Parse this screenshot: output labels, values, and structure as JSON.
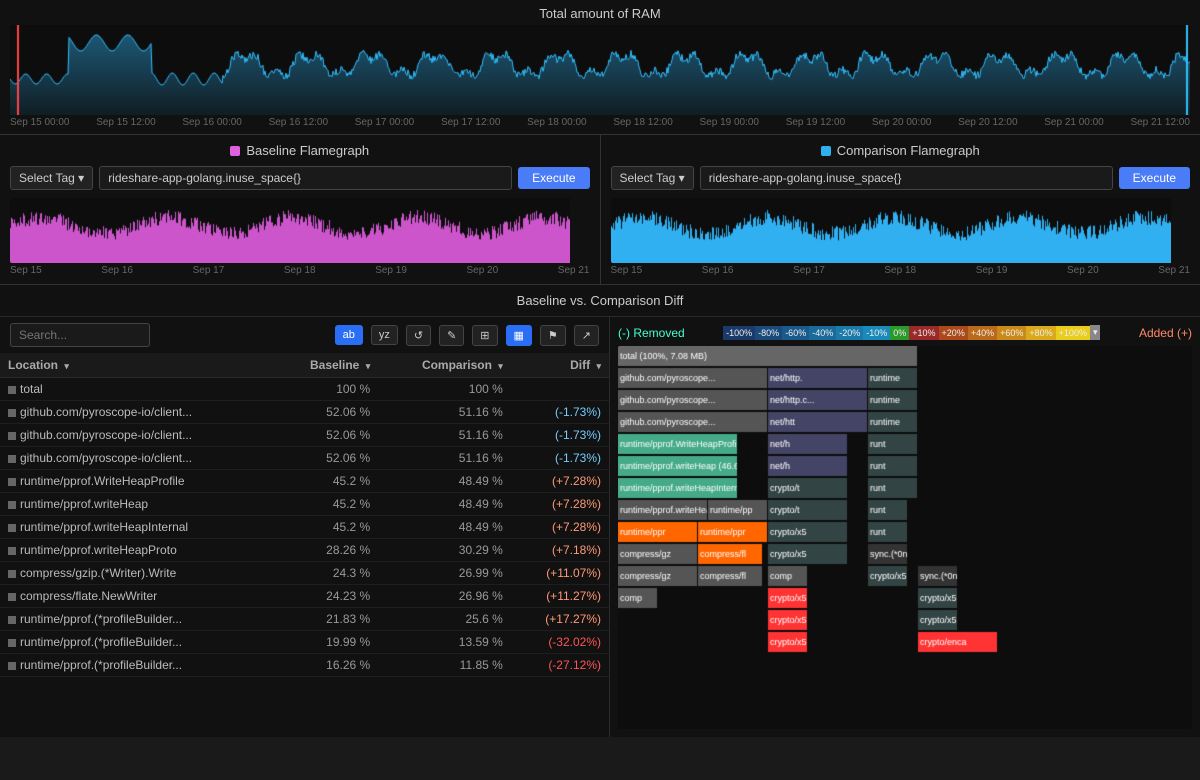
{
  "ram": {
    "title": "Total amount of RAM",
    "timeline": [
      "Sep 15 00:00",
      "Sep 15 12:00",
      "Sep 16 00:00",
      "Sep 16 12:00",
      "Sep 17 00:00",
      "Sep 17 12:00",
      "Sep 18 00:00",
      "Sep 18 12:00",
      "Sep 19 00:00",
      "Sep 19 12:00",
      "Sep 20 00:00",
      "Sep 20 12:00",
      "Sep 21 00:00",
      "Sep 21 12:00"
    ]
  },
  "baseline": {
    "title": "Baseline Flamegraph",
    "color": "#e060e0",
    "select_tag_label": "Select Tag ▾",
    "metric": "rideshare-app-golang.inuse_space{}",
    "execute_label": "Execute",
    "timeline": [
      "Sep 15",
      "Sep 16",
      "Sep 17",
      "Sep 18",
      "Sep 19",
      "Sep 20",
      "Sep 21"
    ]
  },
  "comparison": {
    "title": "Comparison Flamegraph",
    "color": "#30b0f0",
    "select_tag_label": "Select Tag ▾",
    "metric": "rideshare-app-golang.inuse_space{}",
    "execute_label": "Execute",
    "timeline": [
      "Sep 15",
      "Sep 16",
      "Sep 17",
      "Sep 18",
      "Sep 19",
      "Sep 20",
      "Sep 21"
    ]
  },
  "diff": {
    "title": "Baseline vs. Comparison Diff",
    "search_placeholder": "Search...",
    "search_label": "Search",
    "location_label": "Location ▾",
    "toolbar_buttons": [
      "ab",
      "yz",
      "↺",
      "✎",
      "⊞",
      "⬚",
      "⚑",
      "↗"
    ],
    "columns": [
      "Location",
      "Baseline",
      "Comparison",
      "Diff"
    ],
    "rows": [
      {
        "name": "total",
        "baseline": "100 %",
        "comparison": "100 %",
        "diff": ""
      },
      {
        "name": "github.com/pyroscope-io/client...",
        "baseline": "52.06 %",
        "comparison": "51.16 %",
        "diff": "(-1.73%)",
        "diff_class": "diff-negative"
      },
      {
        "name": "github.com/pyroscope-io/client...",
        "baseline": "52.06 %",
        "comparison": "51.16 %",
        "diff": "(-1.73%)",
        "diff_class": "diff-negative"
      },
      {
        "name": "github.com/pyroscope-io/client...",
        "baseline": "52.06 %",
        "comparison": "51.16 %",
        "diff": "(-1.73%)",
        "diff_class": "diff-negative"
      },
      {
        "name": "runtime/pprof.WriteHeapProfile",
        "baseline": "45.2 %",
        "comparison": "48.49 %",
        "diff": "(+7.28%)",
        "diff_class": "diff-positive"
      },
      {
        "name": "runtime/pprof.writeHeap",
        "baseline": "45.2 %",
        "comparison": "48.49 %",
        "diff": "(+7.28%)",
        "diff_class": "diff-positive"
      },
      {
        "name": "runtime/pprof.writeHeapInternal",
        "baseline": "45.2 %",
        "comparison": "48.49 %",
        "diff": "(+7.28%)",
        "diff_class": "diff-positive"
      },
      {
        "name": "runtime/pprof.writeHeapProto",
        "baseline": "28.26 %",
        "comparison": "30.29 %",
        "diff": "(+7.18%)",
        "diff_class": "diff-positive"
      },
      {
        "name": "compress/gzip.(*Writer).Write",
        "baseline": "24.3 %",
        "comparison": "26.99 %",
        "diff": "(+11.07%)",
        "diff_class": "diff-positive"
      },
      {
        "name": "compress/flate.NewWriter",
        "baseline": "24.23 %",
        "comparison": "26.96 %",
        "diff": "(+11.27%)",
        "diff_class": "diff-positive"
      },
      {
        "name": "runtime/pprof.(*profileBuilder...",
        "baseline": "21.83 %",
        "comparison": "25.6 %",
        "diff": "(+17.27%)",
        "diff_class": "diff-positive"
      },
      {
        "name": "runtime/pprof.(*profileBuilder...",
        "baseline": "19.99 %",
        "comparison": "13.59 %",
        "diff": "(-32.02%)",
        "diff_class": "diff-negative2"
      },
      {
        "name": "runtime/pprof.(*profileBuilder...",
        "baseline": "16.26 %",
        "comparison": "11.85 %",
        "diff": "(-27.12%)",
        "diff_class": "diff-negative2"
      }
    ],
    "legend_removed": "(-) Removed",
    "legend_added": "Added (+)",
    "scale_items": [
      "-100%",
      "-80%",
      "-60%",
      "-40%",
      "-20%",
      "-10%",
      "0%",
      "+10%",
      "+20%",
      "+40%",
      "+60%",
      "+80%",
      "+100%",
      "▾"
    ]
  }
}
